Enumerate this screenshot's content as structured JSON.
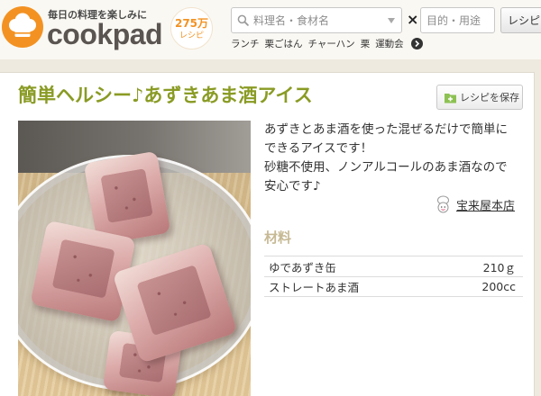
{
  "colors": {
    "brand_orange": "#f39222",
    "title_green": "#8a9b24",
    "ingredients_heading": "#c6b994",
    "page_background": "#eeeae0"
  },
  "icons": {
    "logo": "chef-hat-icon",
    "search": "search-icon",
    "dropdown": "caret-down-icon",
    "more_keywords": "chevron-right-icon",
    "save": "folder-add-icon",
    "author": "chef-avatar-icon"
  },
  "header": {
    "logo_tagline": "毎日の料理を楽しみに",
    "logo_text": "cookpad",
    "recipe_count_number": "275万",
    "recipe_count_label": "レシピ",
    "search": {
      "keyword_placeholder": "料理名・食材名",
      "separator": "×",
      "purpose_placeholder": "目的・用途",
      "button_label": "レシピ"
    },
    "trending_keywords": [
      "ランチ",
      "栗ごはん",
      "チャーハン",
      "栗",
      "運動会"
    ]
  },
  "recipe": {
    "title": "簡単ヘルシー♪あずきあま酒アイス",
    "save_button_label": "レシピを保存",
    "description_lines": [
      "あずきとあま酒を使った混ぜるだけで簡単に",
      "できるアイスです！",
      "砂糖不使用、ノンアルコールのあま酒なので",
      "安心です♪"
    ],
    "author_name": "宝来屋本店",
    "ingredients_heading": "材料",
    "ingredients": [
      {
        "name": "ゆであずき缶",
        "amount": "210ｇ"
      },
      {
        "name": "ストレートあま酒",
        "amount": "200cc"
      }
    ]
  }
}
